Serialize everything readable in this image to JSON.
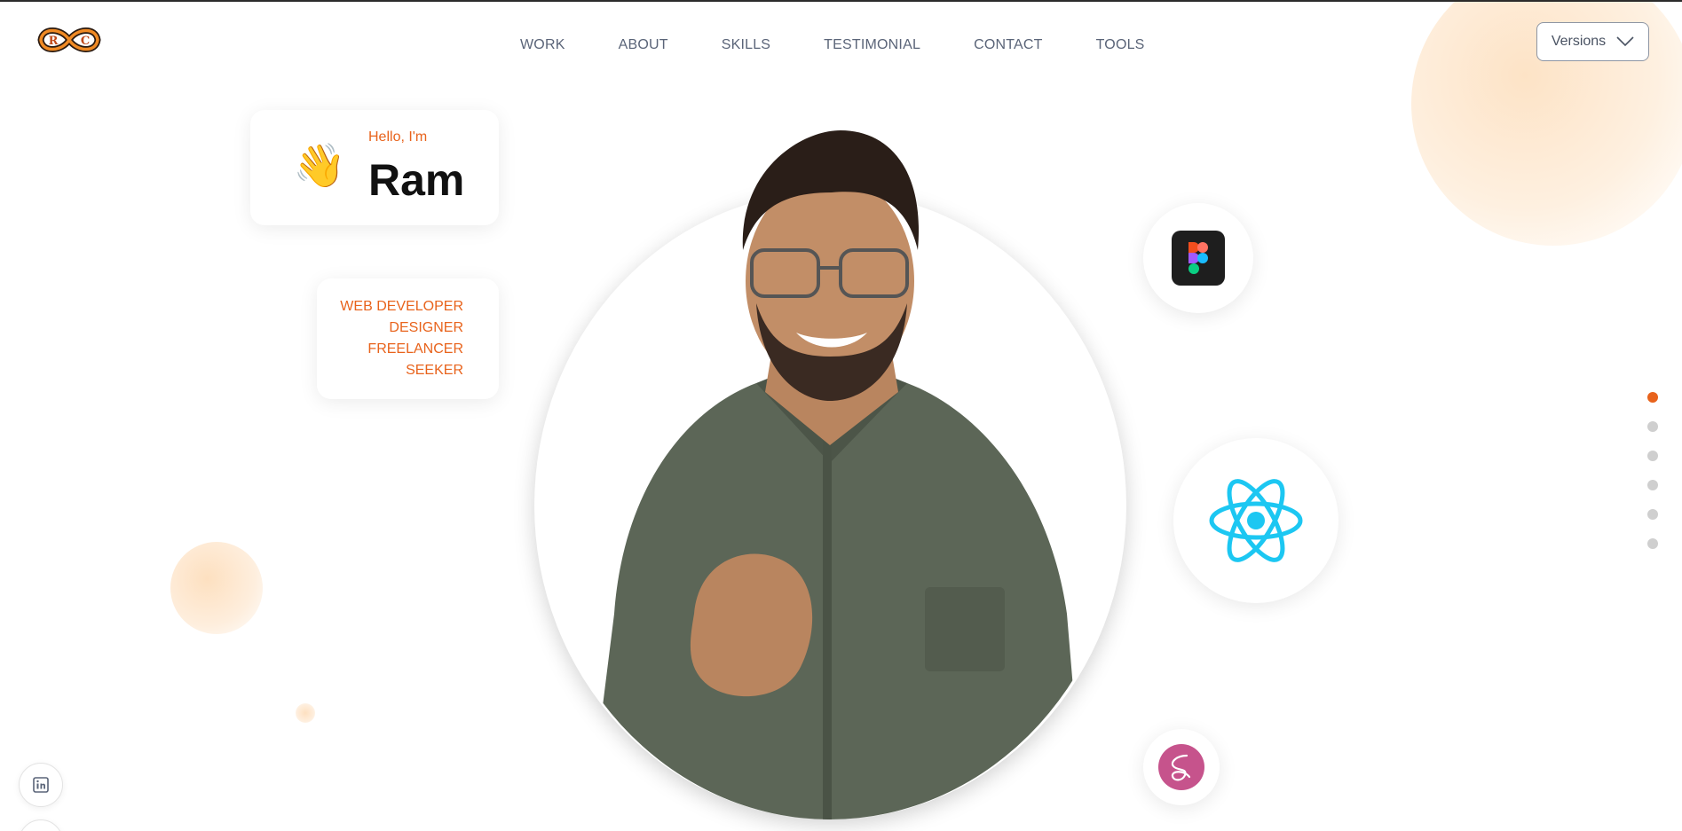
{
  "brand": {
    "logo_letters": "R C",
    "logo_name": "infinity-logo"
  },
  "nav": {
    "items": [
      {
        "label": "WORK"
      },
      {
        "label": "ABOUT"
      },
      {
        "label": "SKILLS"
      },
      {
        "label": "TESTIMONIAL"
      },
      {
        "label": "CONTACT"
      },
      {
        "label": "TOOLS"
      }
    ]
  },
  "versions": {
    "label": "Versions",
    "icon": "chevron-down-icon"
  },
  "hero": {
    "greeting": "Hello, I'm",
    "name": "Ram",
    "wave_emoji": "👋",
    "roles": [
      "WEB DEVELOPER",
      "DESIGNER",
      "FREELANCER",
      "SEEKER"
    ]
  },
  "tech_icons": [
    "figma-icon",
    "react-icon",
    "sass-icon"
  ],
  "page_dots": {
    "count": 6,
    "active_index": 0
  },
  "social": [
    "linkedin-icon",
    "github-icon"
  ],
  "colors": {
    "accent": "#e8631c",
    "nav_text": "#5a6478",
    "react": "#1cc7f2",
    "sass": "#c6538c",
    "figma_bg": "#1e1e1e"
  }
}
